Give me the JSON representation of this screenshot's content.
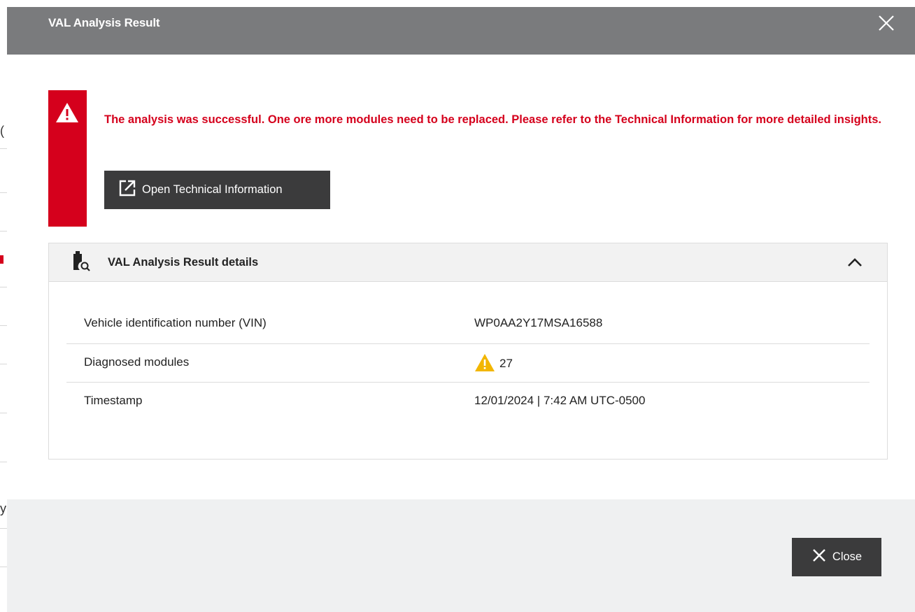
{
  "dialog": {
    "title": "VAL Analysis Result",
    "close_icon": "close-icon"
  },
  "alert": {
    "icon": "warning-triangle-icon",
    "message": "The analysis was successful. One ore more modules need to be replaced. Please refer to the Technical Information for more detailed insights.",
    "button_label": "Open Technical Information",
    "button_icon": "external-link-icon",
    "color": "#d5001c"
  },
  "details": {
    "icon": "battery-search-icon",
    "title": "VAL Analysis Result details",
    "expanded": true,
    "rows": [
      {
        "label": "Vehicle identification number (VIN)",
        "value": "WP0AA2Y17MSA16588"
      },
      {
        "label": "Diagnosed modules",
        "value": "27",
        "value_icon": "warning-icon"
      },
      {
        "label": "Timestamp",
        "value": "12/01/2024 | 7:42 AM UTC-0500"
      }
    ]
  },
  "footer": {
    "close_label": "Close",
    "close_icon": "close-icon"
  },
  "background": {
    "fragments": [
      "(",
      "y"
    ]
  },
  "colors": {
    "header_bg": "#7a7b7d",
    "button_bg": "#3b3b3c",
    "footer_bg": "#eff0f1",
    "warning": "#f2b600"
  }
}
